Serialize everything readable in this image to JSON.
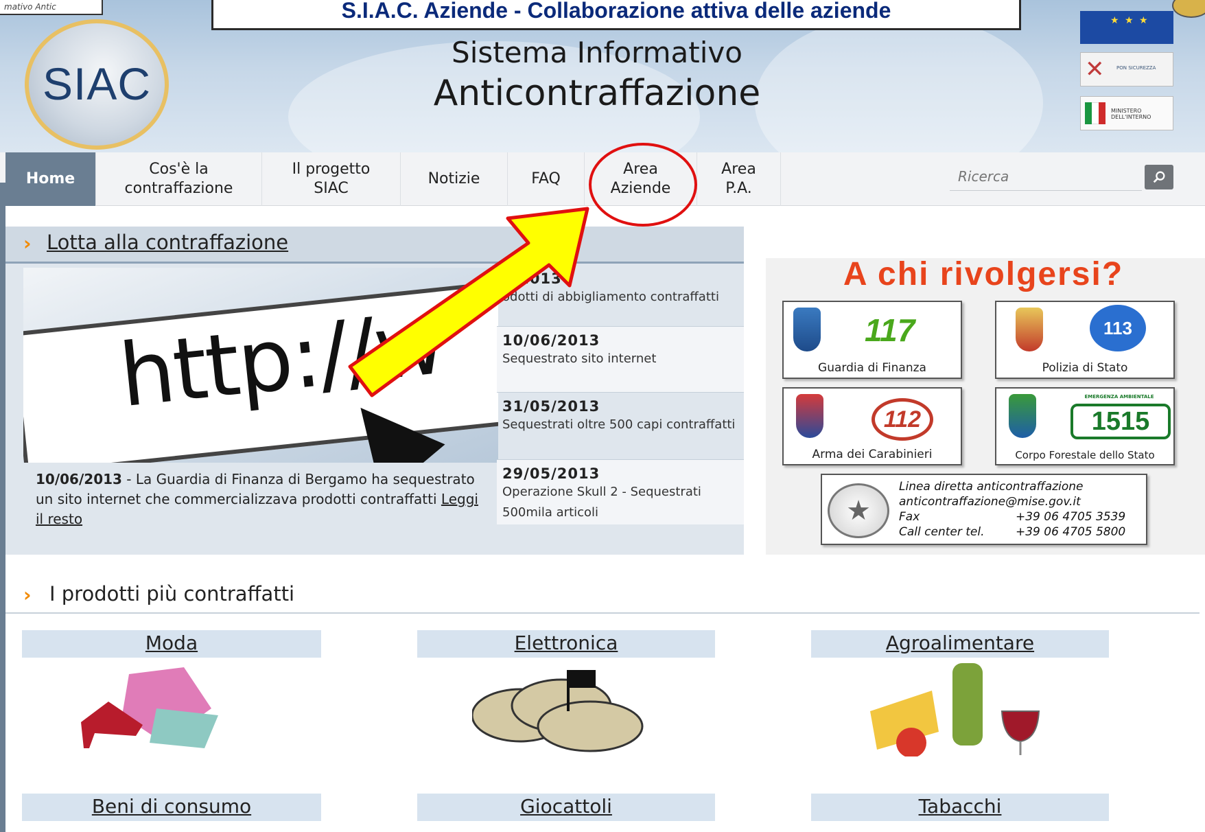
{
  "slide": {
    "title": "S.I.A.C. Aziende - Collaborazione attiva delle aziende",
    "corner_logo_text": "mativo Antic"
  },
  "header": {
    "logo_text": "SIAC",
    "title_line1": "Sistema Informativo",
    "title_line2": "Anticontraffazione",
    "partner_logos": [
      "eu-flag-icon",
      "pon-sicurezza-icon",
      "ministero-interno-icon"
    ]
  },
  "nav": {
    "items": [
      {
        "label": "Home",
        "active": true
      },
      {
        "label": "Cos'è la contraffazione"
      },
      {
        "label": "Il progetto SIAC"
      },
      {
        "label": "Notizie"
      },
      {
        "label": "FAQ"
      },
      {
        "label": "Area Aziende",
        "highlighted": true
      },
      {
        "label": "Area P.A."
      }
    ],
    "search_placeholder": "Ricerca"
  },
  "lotta": {
    "title": "Lotta alla contraffazione",
    "hero_text": "http://w",
    "caption_date": "10/06/2013",
    "caption_text": " - La Guardia di Finanza di Bergamo ha sequestrato un sito internet che commercializzava prodotti contraffatti ",
    "caption_link": "Leggi il resto",
    "news": [
      {
        "date": "6/2013",
        "text": "odotti di abbigliamento contraffatti"
      },
      {
        "date": "10/06/2013",
        "text": "Sequestrato sito internet"
      },
      {
        "date": "31/05/2013",
        "text": "Sequestrati oltre 500 capi contraffatti"
      },
      {
        "date": "29/05/2013",
        "text": "Operazione Skull 2 - Sequestrati 500mila articoli"
      }
    ]
  },
  "rivolgersi": {
    "title": "A chi rivolgersi?",
    "cards": [
      {
        "label": "Guardia di Finanza",
        "number": "117"
      },
      {
        "label": "Polizia di Stato",
        "number": "113"
      },
      {
        "label": "Arma dei Carabinieri",
        "number": "112"
      },
      {
        "label": "Corpo Forestale dello Stato",
        "number": "1515",
        "tag": "EMERGENZA AMBIENTALE"
      }
    ],
    "hotline": {
      "title": "Linea diretta anticontraffazione",
      "email": "anticontraffazione@mise.gov.it",
      "fax_label": "Fax",
      "fax": "+39 06 4705 3539",
      "call_label": "Call center tel.",
      "call": "+39 06 4705 5800"
    }
  },
  "products": {
    "title": "I prodotti più contraffatti",
    "categories": [
      "Moda",
      "Elettronica",
      "Agroalimentare",
      "Beni di consumo",
      "Giocattoli",
      "Tabacchi"
    ]
  },
  "colors": {
    "nav_active": "#6a7e92",
    "callout_red": "#e01010",
    "arrow_yellow": "#ffff00",
    "rivolgersi_orange": "#e8441c",
    "product_label_bg": "#d7e3ef"
  }
}
